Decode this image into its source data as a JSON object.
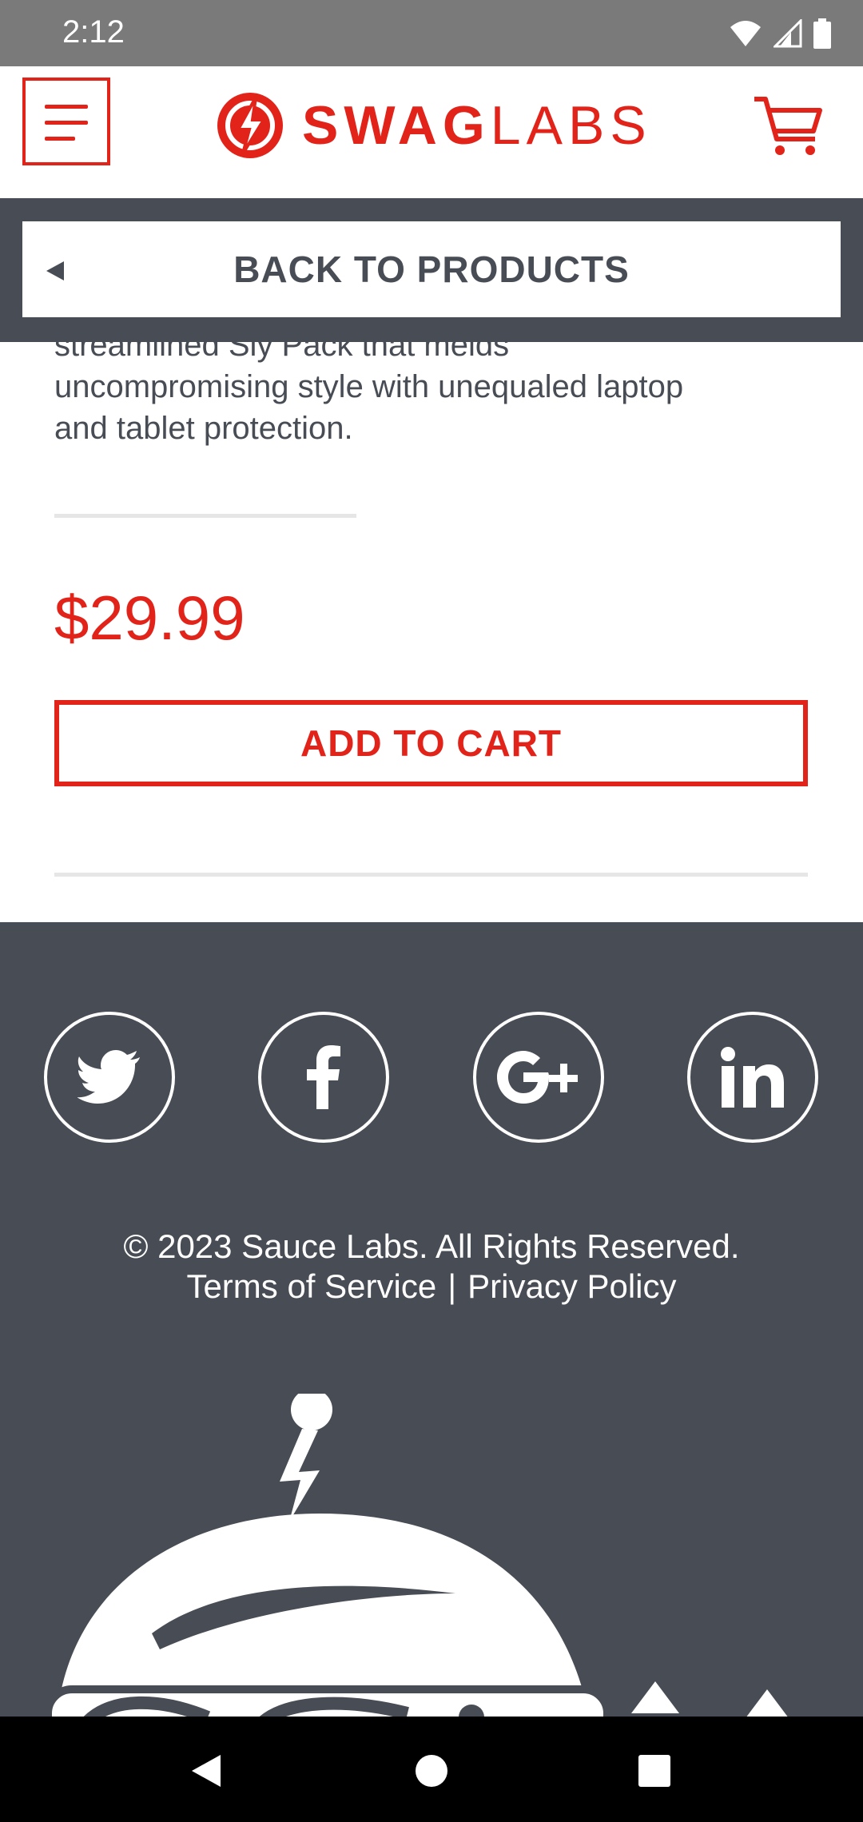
{
  "status_bar": {
    "time": "2:12"
  },
  "header": {
    "logo_bold": "SWAG",
    "logo_light": "LABS",
    "brand_color": "#e2231a"
  },
  "back_bar": {
    "label": "BACK TO PRODUCTS"
  },
  "product": {
    "description_lines": [
      "streamlined Sly Pack that melds",
      "uncompromising style with unequaled laptop",
      "and tablet protection."
    ],
    "price": "$29.99",
    "add_to_cart_label": "ADD TO CART"
  },
  "footer": {
    "social_icons": [
      "twitter-icon",
      "facebook-icon",
      "google-plus-icon",
      "linkedin-icon"
    ],
    "copyright": "© 2023 Sauce Labs. All Rights Reserved.",
    "terms_label": "Terms of Service",
    "separator": "|",
    "privacy_label": "Privacy Policy"
  },
  "colors": {
    "accent": "#e2231a",
    "dark": "#484c55",
    "status_bar": "#7a7a7a"
  }
}
